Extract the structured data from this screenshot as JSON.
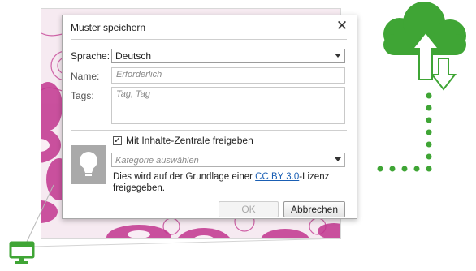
{
  "dialog": {
    "title": "Muster speichern",
    "close_glyph": "✕",
    "language": {
      "label": "Sprache:",
      "value": "Deutsch"
    },
    "name": {
      "label": "Name:",
      "placeholder": "Erforderlich"
    },
    "tags": {
      "label": "Tags:",
      "placeholder": "Tag, Tag"
    },
    "share": {
      "checkbox_checked": true,
      "check_glyph": "✓",
      "label": "Mit Inhalte-Zentrale freigeben",
      "category_placeholder": "Kategorie auswählen",
      "license_prefix": "Dies wird auf der Grundlage einer ",
      "license_link": "CC BY 3.0",
      "license_suffix": "-Lizenz freigegeben."
    },
    "buttons": {
      "ok": "OK",
      "cancel": "Abbrechen"
    }
  },
  "colors": {
    "accent_green": "#3fa535",
    "pattern_pink": "#c2368f",
    "pattern_bg": "#f6eaf1",
    "link_blue": "#1a5fb4"
  },
  "icons": {
    "thumbnail": "lightbulb-icon",
    "monitor": "monitor-icon",
    "cloud": "cloud-sync-icon"
  }
}
